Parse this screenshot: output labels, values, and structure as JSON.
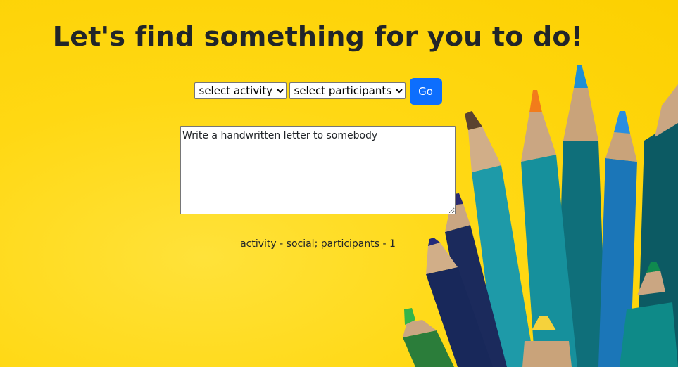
{
  "page": {
    "heading": "Let's find something for you to do!"
  },
  "controls": {
    "activity_select": {
      "selected": "select activity",
      "options": [
        "select activity"
      ]
    },
    "participants_select": {
      "selected": "select participants",
      "options": [
        "select participants"
      ]
    },
    "go_label": "Go"
  },
  "result": {
    "text": "Write a handwritten letter to somebody",
    "info": "activity - social; participants - 1"
  },
  "colors": {
    "background": "#ffd813",
    "button": "#0d6efd",
    "heading": "#212529"
  },
  "background_art": {
    "description_icon": "colored-pencils-image"
  }
}
